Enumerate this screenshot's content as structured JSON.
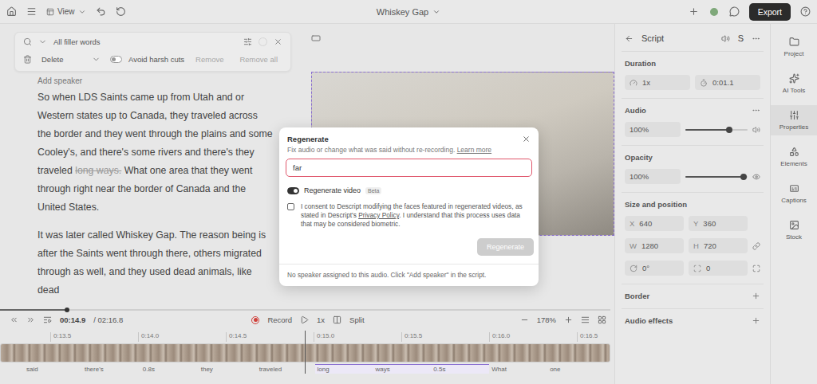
{
  "topbar": {
    "view_menu": "View",
    "title": "Whiskey Gap",
    "export": "Export"
  },
  "filler_search": {
    "query": "All filler words",
    "action": "Delete",
    "avoid_harsh_cuts": {
      "label": "Avoid harsh cuts",
      "on": false
    },
    "buttons": [
      {
        "label": "Remove",
        "disabled": true
      },
      {
        "label": "Remove all",
        "disabled": true
      }
    ]
  },
  "script": {
    "speaker": "Add speaker",
    "paragraphs": [
      [
        {
          "text": "So when LDS Saints came up from Utah and or Western states up to Canada, they traveled across the border and they went through the plains and some Cooley's, and there's some rivers and there's they traveled ",
          "struck": false
        },
        {
          "text": "long ways.",
          "struck": true
        },
        {
          "text": " What one area that they went through right near the border of Canada and the United States.",
          "struck": false
        }
      ],
      [
        {
          "text": "It was later called Whiskey Gap. The reason being is after the Saints went through there, others migrated through as well, and they used dead animals, like dead",
          "struck": false
        }
      ]
    ]
  },
  "modal": {
    "title": "Regenerate",
    "subtitle": "Fix audio or change what was said without re-recording.",
    "link": "Learn more",
    "input": "far",
    "regenerate_video": {
      "label": "Regenerate video",
      "on": true,
      "badge": "Beta"
    },
    "consent": {
      "checked": false,
      "before": "I consent to Descript modifying the faces featured in regenerated videos, as stated in Descript's ",
      "link": "Privacy Policy",
      "after": ". I understand that this process uses data that may be considered biometric."
    },
    "button": {
      "label": "Regenerate",
      "disabled": true
    },
    "footer": "No speaker assigned to this audio. Click \"Add speaker\" in the script."
  },
  "properties": {
    "header": "Script",
    "shortcut": "S",
    "duration": {
      "label": "Duration",
      "speed": "1x",
      "length": "0:01.1"
    },
    "audio": {
      "label": "Audio",
      "value": "100%",
      "level": 0.7
    },
    "opacity": {
      "label": "Opacity",
      "value": "100%",
      "level": 0.94
    },
    "size": {
      "label": "Size and position",
      "fields": [
        {
          "label": "X",
          "value": "640"
        },
        {
          "label": "Y",
          "value": "360"
        },
        {
          "label": "W",
          "value": "1280"
        },
        {
          "label": "H",
          "value": "720"
        }
      ],
      "rotation": "0°",
      "corner": "0"
    },
    "extras": [
      "Border",
      "Audio effects"
    ]
  },
  "rail": [
    {
      "label": "Project",
      "selected": false
    },
    {
      "label": "AI Tools",
      "selected": false
    },
    {
      "label": "Properties",
      "selected": true
    },
    {
      "label": "Elements",
      "selected": false
    },
    {
      "label": "Captions",
      "selected": false
    },
    {
      "label": "Stock",
      "selected": false
    }
  ],
  "transport": {
    "current": "00:14.9",
    "total": "/ 02:16.8",
    "record": "Record",
    "speed": "1x",
    "split": "Split",
    "zoom": "178%"
  },
  "scrub": {
    "level": 0.11
  },
  "timeline": {
    "ticks": [
      "0:13.5",
      "0:14.0",
      "0:14.5",
      "0:15.0",
      "0:15.5",
      "0:16.0",
      "0:16.5"
    ],
    "words": [
      {
        "text": "said",
        "selected": false
      },
      {
        "text": "there's",
        "selected": false
      },
      {
        "text": "0.8s",
        "selected": false
      },
      {
        "text": "they",
        "selected": false
      },
      {
        "text": "traveled",
        "selected": false
      },
      {
        "text": "long",
        "selected": true
      },
      {
        "text": "ways",
        "selected": true
      },
      {
        "text": "0.5s",
        "selected": true
      },
      {
        "text": "What",
        "selected": false
      },
      {
        "text": "one",
        "selected": false
      }
    ]
  }
}
